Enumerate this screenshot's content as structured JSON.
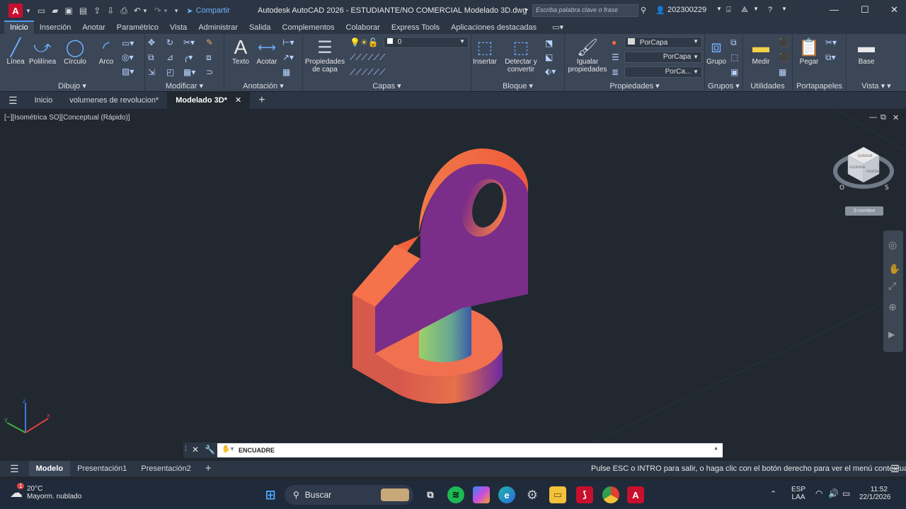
{
  "titlebar": {
    "app_letter": "A",
    "share_label": "Compartir",
    "title": "Autodesk AutoCAD 2026 - ESTUDIANTE/NO COMERCIAL    Modelado 3D.dwg",
    "search_placeholder": "Escriba palabra clave o frase",
    "user": "202300229"
  },
  "ribbon_tabs": [
    "Inicio",
    "Inserción",
    "Anotar",
    "Paramétrico",
    "Vista",
    "Administrar",
    "Salida",
    "Complementos",
    "Colaborar",
    "Express Tools",
    "Aplicaciones destacadas"
  ],
  "ribbon": {
    "dibujo": {
      "title": "Dibujo",
      "tools": [
        "Línea",
        "Polilínea",
        "Círculo",
        "Arco"
      ]
    },
    "modificar": {
      "title": "Modificar"
    },
    "anotacion": {
      "title": "Anotación",
      "tools": [
        "Texto",
        "Acotar"
      ]
    },
    "capas": {
      "title": "Capas",
      "tool": "Propiedades de capa",
      "tool_line1": "Propiedades",
      "tool_line2": "de capa",
      "layer_value": "0"
    },
    "bloque": {
      "title": "Bloque",
      "tools": [
        "Insertar",
        "Detectar y convertir"
      ]
    },
    "propiedades": {
      "title": "Propiedades",
      "tool_line1": "Igualar",
      "tool_line2": "propiedades",
      "color": "PorCapa",
      "linetype": "PorCapa",
      "lineweight": "PorCa..."
    },
    "grupos": {
      "title": "Grupos",
      "tool": "Grupo"
    },
    "utilidades": {
      "title": "Utilidades",
      "tool": "Medir"
    },
    "portapapeles": {
      "title": "Portapapeles",
      "tool": "Pegar"
    },
    "vista": {
      "title": "Vista",
      "tool": "Base"
    }
  },
  "doc_tabs": [
    "Inicio",
    "volumenes de revolucion*",
    "Modelado 3D*"
  ],
  "viewport": {
    "label": "[−][Isométrica SO][Conceptual (Rápido)]",
    "viewcube_label": "S-nombre",
    "viewcube_faces": [
      "SUPERIOR",
      "FRONTAL",
      "IZQUIERDA"
    ],
    "compass_letters": [
      "O",
      "S"
    ]
  },
  "command": {
    "text": "ENCUADRE"
  },
  "layout_tabs": [
    "Modelo",
    "Presentación1",
    "Presentación2"
  ],
  "status_message": "Pulse ESC o INTRO para salir, o haga clic con el botón derecho para ver el menú contextual.",
  "taskbar": {
    "weather_temp": "20°C",
    "weather_desc": "Mayorm. nublado",
    "weather_badge": "1",
    "search_label": "Buscar",
    "lang": "ESP",
    "lang_sub": "LAA",
    "time": "11:52",
    "date": "22/1/2026"
  },
  "colors": {
    "accent": "#4d9bf0",
    "solid_orange": "#f26a3f",
    "solid_purple": "#7b2d8a",
    "solid_green": "#a7e067"
  }
}
